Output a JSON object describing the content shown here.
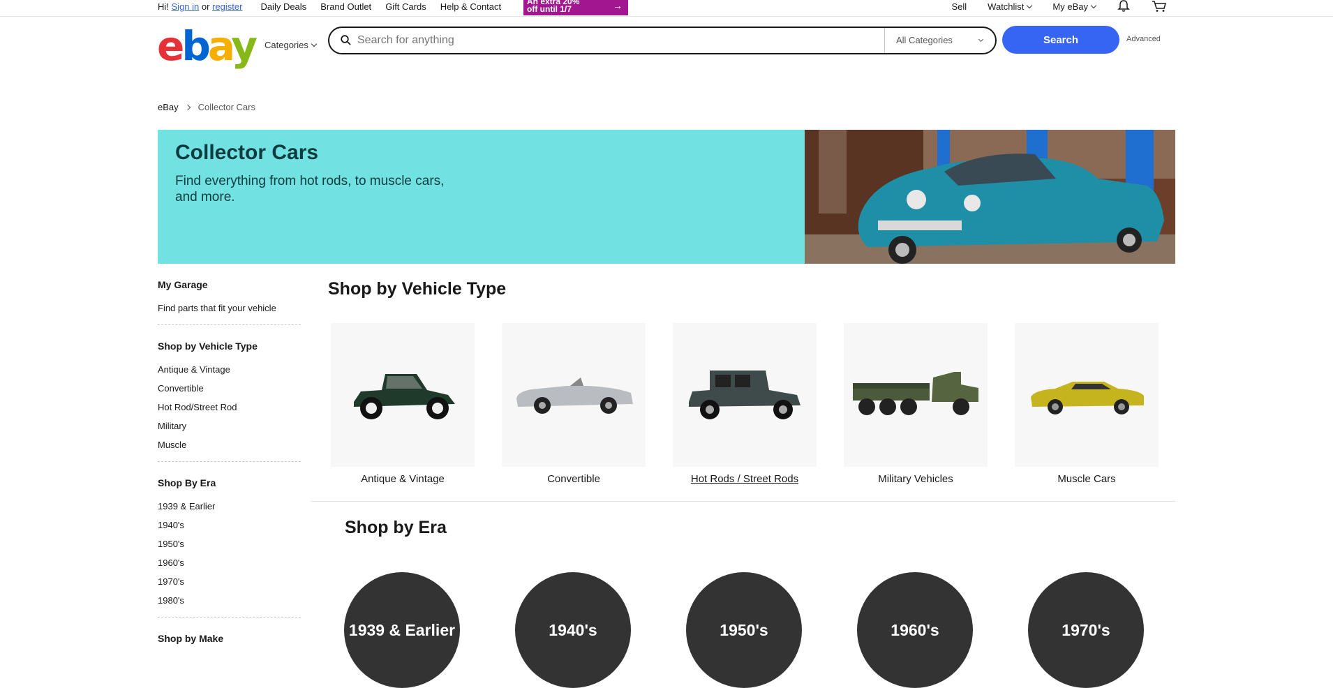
{
  "topbar": {
    "greeting_prefix": "Hi!",
    "sign_in": "Sign in",
    "or": "or",
    "register": "register",
    "links": [
      "Daily Deals",
      "Brand Outlet",
      "Gift Cards",
      "Help & Contact"
    ],
    "promo_line1": "An extra 20%",
    "promo_line2": "off until 1/7",
    "sell": "Sell",
    "watchlist": "Watchlist",
    "my_ebay": "My eBay"
  },
  "header": {
    "logo": [
      "e",
      "b",
      "a",
      "y"
    ],
    "categories": "Categories",
    "search_placeholder": "Search for anything",
    "category_select": "All Categories",
    "search_button": "Search",
    "advanced": "Advanced"
  },
  "breadcrumb": {
    "home": "eBay",
    "current": "Collector Cars"
  },
  "hero": {
    "title": "Collector Cars",
    "subtitle": "Find everything from hot rods, to muscle cars, and more."
  },
  "sidebar": {
    "garage_title": "My Garage",
    "garage_link": "Find parts that fit your vehicle",
    "vehicle_type_title": "Shop by Vehicle Type",
    "vehicle_types": [
      "Antique & Vintage",
      "Convertible",
      "Hot Rod/Street Rod",
      "Military",
      "Muscle"
    ],
    "era_title": "Shop By Era",
    "eras": [
      "1939 & Earlier",
      "1940's",
      "1950's",
      "1960's",
      "1970's",
      "1980's"
    ],
    "next_title": "Shop by Make"
  },
  "main": {
    "vehicle_type_title": "Shop by Vehicle Type",
    "tiles": [
      "Antique & Vintage",
      "Convertible",
      "Hot Rods / Street Rods",
      "Military Vehicles",
      "Muscle Cars"
    ],
    "era_title": "Shop by Era",
    "eras": [
      "1939 & Earlier",
      "1940's",
      "1950's",
      "1960's",
      "1970's"
    ]
  },
  "colors": {
    "accent": "#3665f3",
    "hero_bg": "#71e2e1",
    "promo_bg": "#a2168f",
    "era_circle": "#333333"
  }
}
